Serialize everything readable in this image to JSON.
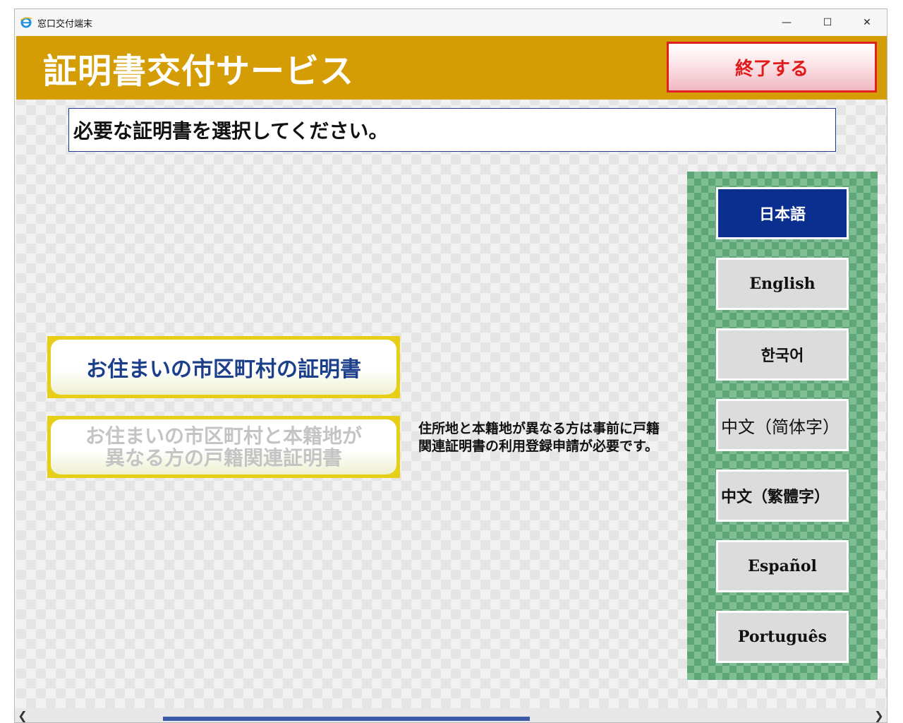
{
  "window": {
    "title": "窓口交付端末",
    "controls": {
      "minimize": "—",
      "maximize": "☐",
      "close": "✕"
    }
  },
  "header": {
    "title": "証明書交付サービス",
    "exit_label": "終了する"
  },
  "instruction": "必要な証明書を選択してください。",
  "certificates": [
    {
      "label": "お住まいの市区町村の証明書",
      "enabled": true
    },
    {
      "label_line1": "お住まいの市区町村と本籍地が",
      "label_line2": "異なる方の戸籍関連証明書",
      "enabled": false
    }
  ],
  "note": "住所地と本籍地が異なる方は事前に戸籍関連証明書の利用登録申請が必要です。",
  "languages": [
    {
      "label": "日本語",
      "selected": true
    },
    {
      "label": "English",
      "selected": false
    },
    {
      "label": "한국어",
      "selected": false
    },
    {
      "label": "中文（简体字）",
      "selected": false
    },
    {
      "label": "中文（繁體字）",
      "selected": false
    },
    {
      "label": "Español",
      "selected": false
    },
    {
      "label": "Português",
      "selected": false
    }
  ],
  "colors": {
    "header_bg": "#d49d06",
    "exit_border": "#e02020",
    "selected_lang_bg": "#0a2f8e",
    "lang_panel_bg": "#5ea678",
    "cert_frame": "#e6cf16",
    "cert_text": "#1c3f8b"
  },
  "icons": {
    "app": "browser-e-icon",
    "scroll_left": "chevron-left-icon",
    "scroll_right": "chevron-right-icon"
  }
}
